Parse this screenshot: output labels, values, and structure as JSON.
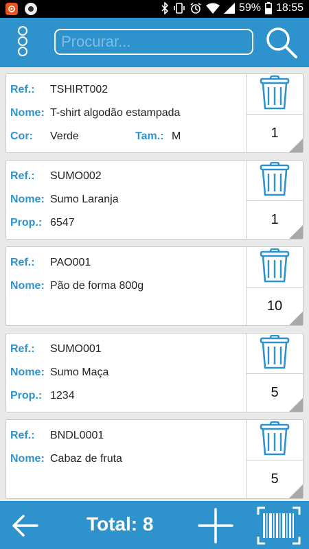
{
  "status_bar": {
    "battery": "59%",
    "time": "18:55"
  },
  "toolbar": {
    "search_placeholder": "Procurar..."
  },
  "items": [
    {
      "rows": [
        {
          "label": "Ref.:",
          "value": "TSHIRT002"
        },
        {
          "label": "Nome:",
          "value": "T-shirt algodão estampada"
        },
        {
          "label": "Cor:",
          "value": "Verde",
          "label2": "Tam.:",
          "value2": "M"
        }
      ],
      "quantity": "1"
    },
    {
      "rows": [
        {
          "label": "Ref.:",
          "value": "SUMO002"
        },
        {
          "label": "Nome:",
          "value": "Sumo Laranja"
        },
        {
          "label": "Prop.:",
          "value": "6547"
        }
      ],
      "quantity": "1"
    },
    {
      "rows": [
        {
          "label": "Ref.:",
          "value": "PAO001"
        },
        {
          "label": "Nome:",
          "value": "Pão de forma 800g"
        }
      ],
      "quantity": "10"
    },
    {
      "rows": [
        {
          "label": "Ref.:",
          "value": "SUMO001"
        },
        {
          "label": "Nome:",
          "value": "Sumo Maça"
        },
        {
          "label": "Prop.:",
          "value": "1234"
        }
      ],
      "quantity": "5"
    },
    {
      "rows": [
        {
          "label": "Ref.:",
          "value": "BNDL0001"
        },
        {
          "label": "Nome:",
          "value": "Cabaz de fruta"
        }
      ],
      "quantity": "5"
    }
  ],
  "footer": {
    "total": "Total: 8"
  },
  "colors": {
    "accent": "#2e93cd",
    "background": "#e9e9e9",
    "card": "#ffffff"
  }
}
